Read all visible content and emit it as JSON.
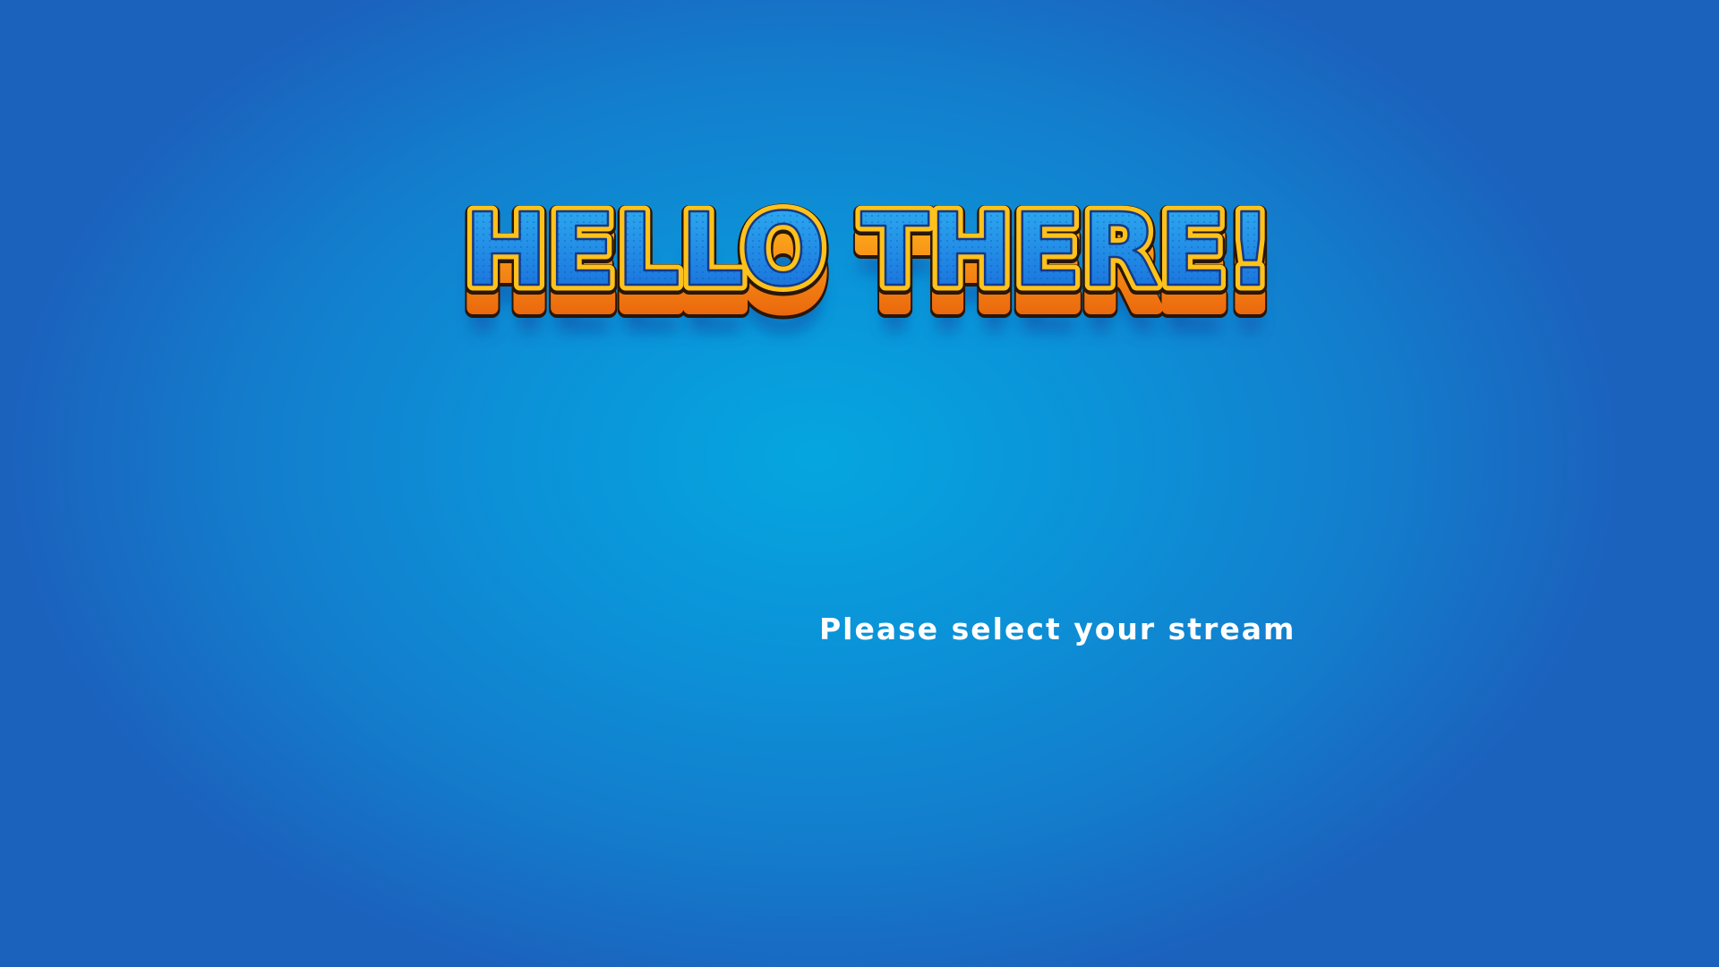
{
  "screen": {
    "title": "HELLO THERE!",
    "subtitle": "Please select your stream"
  },
  "colors": {
    "background_center": "#05a6e0",
    "background_edge": "#1b62bd",
    "title_fill": "#1e8fe6",
    "title_outline": "#ffc21a",
    "title_extrude": "#f07a10",
    "subtitle_text": "#ffffff"
  }
}
